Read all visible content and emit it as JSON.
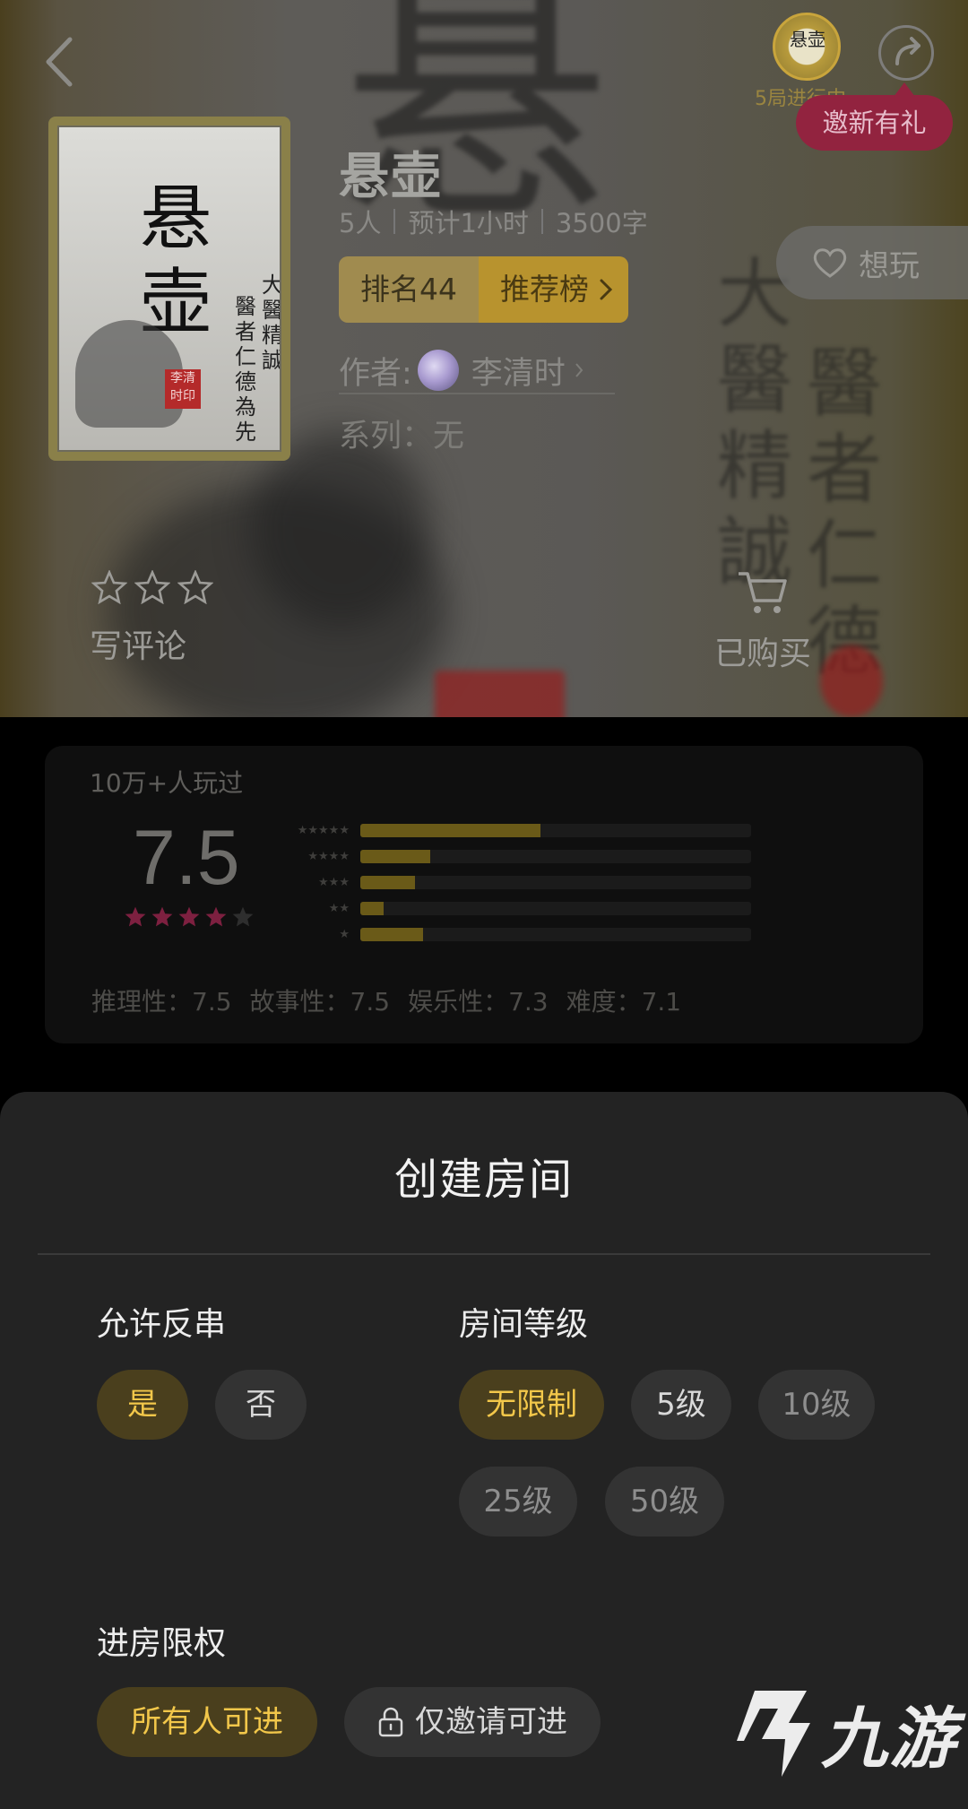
{
  "header": {
    "games_in_progress": "5局进行中",
    "avatar_glyph": "悬壶",
    "invite_badge": "邀新有礼"
  },
  "game": {
    "title": "悬壶",
    "players": "5人",
    "duration": "预计1小时",
    "words": "3500字",
    "rank": "排名44",
    "rank_list": "推荐榜",
    "author_label": "作者:",
    "author_name": "李清时",
    "series": "系列：无",
    "want_label": "想玩",
    "cover": {
      "title": "悬壶",
      "line1": "大醫精誠",
      "line2": "醫者仁德為先",
      "seal": "李清时印"
    }
  },
  "actions": {
    "review_label": "写评论",
    "bought_label": "已购买"
  },
  "rating": {
    "played": "10万+人玩过",
    "score": "7.5",
    "score_value": 7.5,
    "stars_filled": 4,
    "distribution": [
      {
        "stars": 5,
        "fraction": 0.46
      },
      {
        "stars": 4,
        "fraction": 0.18
      },
      {
        "stars": 3,
        "fraction": 0.14
      },
      {
        "stars": 2,
        "fraction": 0.06
      },
      {
        "stars": 1,
        "fraction": 0.16
      }
    ],
    "subscores": [
      "推理性：7.5",
      "故事性：7.5",
      "娱乐性：7.3",
      "难度：7.1"
    ]
  },
  "sheet": {
    "title": "创建房间",
    "allow_counter": {
      "label": "允许反串",
      "options": [
        "是",
        "否"
      ],
      "selected": "是"
    },
    "room_level": {
      "label": "房间等级",
      "options": [
        "无限制",
        "5级",
        "10级",
        "25级",
        "50级"
      ],
      "selected": "无限制"
    },
    "entry": {
      "label": "进房限权",
      "options": [
        "所有人可进",
        "仅邀请可进"
      ],
      "selected": "所有人可进"
    }
  },
  "watermark": {
    "text": "九游"
  },
  "colors": {
    "accent_gold": "#f2c74a",
    "chip_active_bg": "#4a3f1d",
    "sheet_bg": "#232323",
    "invite_badge": "#92233f",
    "star_pink": "#7d2040"
  },
  "icons": {
    "back": "chevron-left-icon",
    "share": "share-icon",
    "heart": "heart-icon",
    "cart": "cart-icon",
    "lock": "lock-icon",
    "star": "star-icon"
  }
}
